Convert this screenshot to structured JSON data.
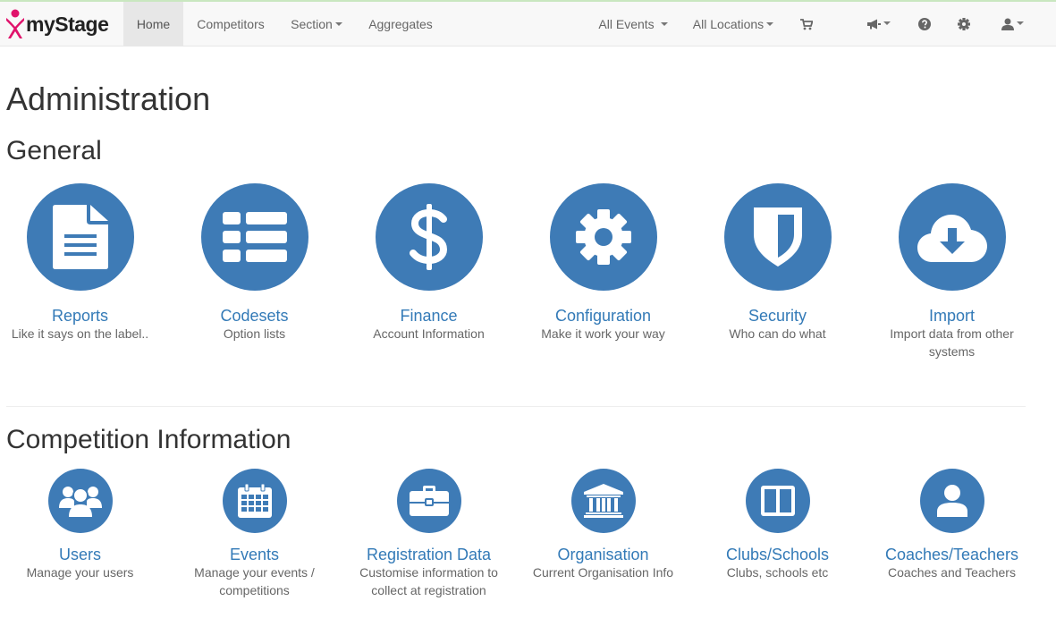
{
  "brand": {
    "name": "myStage"
  },
  "navbar": {
    "home": "Home",
    "competitors": "Competitors",
    "section": "Section",
    "aggregates": "Aggregates",
    "all_events": "All Events",
    "all_locations": "All Locations",
    "icons": [
      "cart-icon",
      "megaphone-icon",
      "help-icon",
      "gear-icon",
      "user-icon"
    ]
  },
  "page": {
    "title": "Administration",
    "general_heading": "General",
    "competition_heading": "Competition Information"
  },
  "general": [
    {
      "title": "Reports",
      "desc": "Like it says on the label..",
      "icon": "file-text-icon"
    },
    {
      "title": "Codesets",
      "desc": "Option lists",
      "icon": "list-icon"
    },
    {
      "title": "Finance",
      "desc": "Account Information",
      "icon": "dollar-icon"
    },
    {
      "title": "Configuration",
      "desc": "Make it work your way",
      "icon": "cog-icon"
    },
    {
      "title": "Security",
      "desc": "Who can do what",
      "icon": "shield-icon"
    },
    {
      "title": "Import",
      "desc": "Import data from other systems",
      "icon": "cloud-download-icon"
    }
  ],
  "competition": [
    {
      "title": "Users",
      "desc": "Manage your users",
      "icon": "users-icon"
    },
    {
      "title": "Events",
      "desc": "Manage your events / competitions",
      "icon": "calendar-icon"
    },
    {
      "title": "Registration Data",
      "desc": "Customise information to collect at registration",
      "icon": "briefcase-icon"
    },
    {
      "title": "Organisation",
      "desc": "Current Organisation Info",
      "icon": "institution-icon"
    },
    {
      "title": "Clubs/Schools",
      "desc": "Clubs, schools etc",
      "icon": "columns-icon"
    },
    {
      "title": "Coaches/Teachers",
      "desc": "Coaches and Teachers",
      "icon": "user-icon"
    }
  ],
  "colors": {
    "accent": "#3e7bb6",
    "link": "#337ab7",
    "logo": "#e0126b"
  }
}
